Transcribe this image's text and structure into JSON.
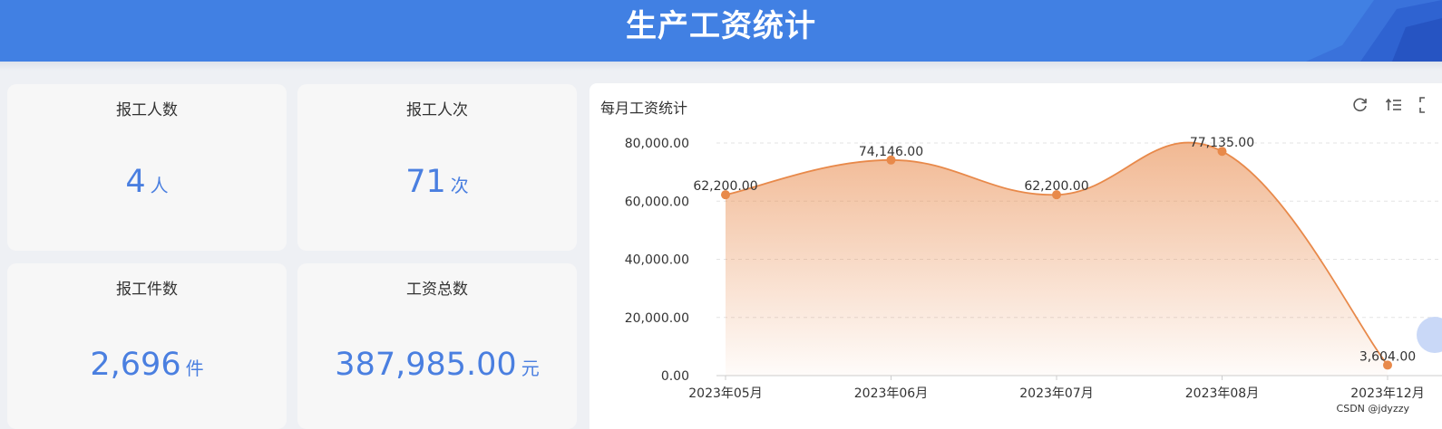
{
  "header": {
    "title": "生产工资统计"
  },
  "stats": [
    {
      "title": "报工人数",
      "value": "4",
      "unit": "人"
    },
    {
      "title": "报工人次",
      "value": "71",
      "unit": "次"
    },
    {
      "title": "报工件数",
      "value": "2,696",
      "unit": "件"
    },
    {
      "title": "工资总数",
      "value": "387,985.00",
      "unit": "元"
    }
  ],
  "chart": {
    "title": "每月工资统计",
    "toolbox": [
      "refresh-icon",
      "data-view-icon",
      "fullscreen-icon"
    ]
  },
  "chart_data": {
    "type": "area",
    "categories": [
      "2023年05月",
      "2023年06月",
      "2023年07月",
      "2023年08月",
      "2023年12月"
    ],
    "values": [
      62200,
      74146,
      62200,
      77135,
      3604
    ],
    "value_labels": [
      "62,200.00",
      "74,146.00",
      "62,200.00",
      "77,135.00",
      "3,604.00"
    ],
    "yticks": [
      "0.00",
      "20,000.00",
      "40,000.00",
      "60,000.00",
      "80,000.00"
    ],
    "ylim": [
      0,
      80000
    ],
    "smooth": true,
    "grid": "y-dashed",
    "color": "#e8894a",
    "legend": "none"
  },
  "watermark": "CSDN @jdyzzy"
}
